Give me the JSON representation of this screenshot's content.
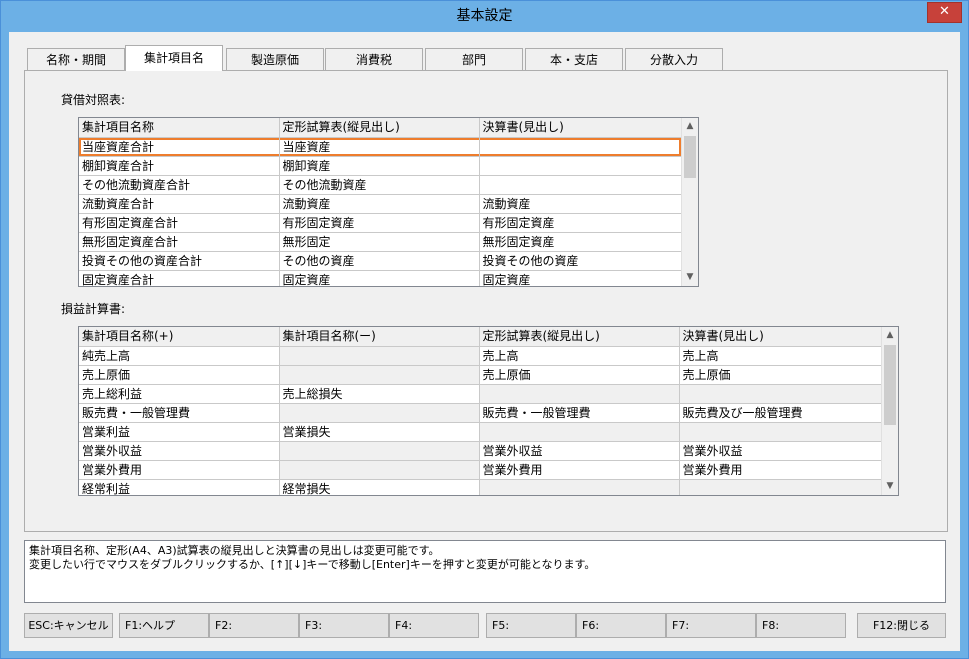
{
  "window": {
    "title": "基本設定",
    "close_label": "✕"
  },
  "tabs": [
    "名称・期間",
    "集計項目名",
    "製造原価",
    "消費税",
    "部門",
    "本・支店",
    "分散入力"
  ],
  "balance_sheet": {
    "label": "貸借対照表:",
    "headers": [
      "集計項目名称",
      "定形試算表(縦見出し)",
      "決算書(見出し)"
    ],
    "rows": [
      [
        "当座資産合計",
        "当座資産",
        ""
      ],
      [
        "棚卸資産合計",
        "棚卸資産",
        ""
      ],
      [
        "その他流動資産合計",
        "その他流動資産",
        ""
      ],
      [
        "流動資産合計",
        "流動資産",
        "流動資産"
      ],
      [
        "有形固定資産合計",
        "有形固定資産",
        "有形固定資産"
      ],
      [
        "無形固定資産合計",
        "無形固定",
        "無形固定資産"
      ],
      [
        "投資その他の資産合計",
        "その他の資産",
        "投資その他の資産"
      ],
      [
        "固定資産合計",
        "固定資産",
        "固定資産"
      ]
    ]
  },
  "income_statement": {
    "label": "損益計算書:",
    "headers": [
      "集計項目名称(+)",
      "集計項目名称(ー)",
      "定形試算表(縦見出し)",
      "決算書(見出し)"
    ],
    "rows": [
      [
        "純売上高",
        "",
        "売上高",
        "売上高"
      ],
      [
        "売上原価",
        "",
        "売上原価",
        "売上原価"
      ],
      [
        "売上総利益",
        "売上総損失",
        "",
        ""
      ],
      [
        "販売費・一般管理費",
        "",
        "販売費・一般管理費",
        "販売費及び一般管理費"
      ],
      [
        "営業利益",
        "営業損失",
        "",
        ""
      ],
      [
        "営業外収益",
        "",
        "営業外収益",
        "営業外収益"
      ],
      [
        "営業外費用",
        "",
        "営業外費用",
        "営業外費用"
      ],
      [
        "経常利益",
        "経常損失",
        "",
        ""
      ]
    ]
  },
  "message": {
    "line1": "集計項目名称、定形(A4、A3)試算表の縦見出しと決算書の見出しは変更可能です。",
    "line2": "変更したい行でマウスをダブルクリックするか、[↑][↓]キーで移動し[Enter]キーを押すと変更が可能となります。"
  },
  "fkeys": [
    "ESC:キャンセル",
    "F1:ヘルプ",
    "F2:",
    "F3:",
    "F4:",
    "F5:",
    "F6:",
    "F7:",
    "F8:",
    "F12:閉じる"
  ]
}
